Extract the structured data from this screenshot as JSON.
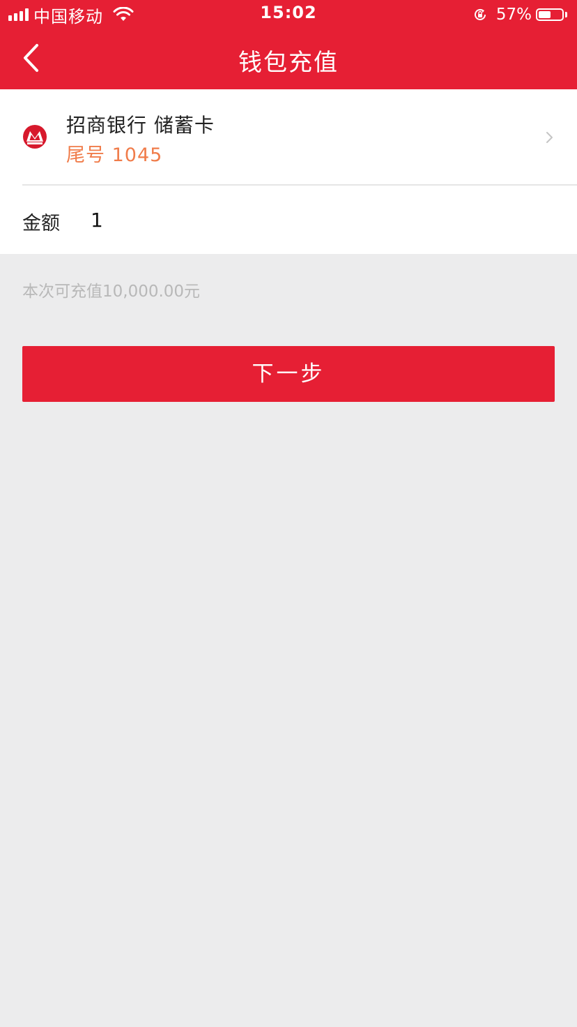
{
  "status_bar": {
    "carrier": "中国移动",
    "time": "15:02",
    "battery_percent": "57%",
    "battery_level": 0.57,
    "icons": [
      "signal-icon",
      "wifi-icon",
      "rotation-lock-icon",
      "battery-icon"
    ]
  },
  "nav": {
    "title": "钱包充值",
    "back_icon": "chevron-left-icon"
  },
  "card": {
    "bank_name": "招商银行 储蓄卡",
    "tail": "尾号 1045",
    "logo_icon": "cmb-logo-icon",
    "chevron_icon": "chevron-right-icon"
  },
  "amount": {
    "label": "金额",
    "value": "1"
  },
  "limit_hint": "本次可充值10,000.00元",
  "next_button": "下一步",
  "colors": {
    "brand_red": "#e61f34",
    "tail_orange": "#f07c4a",
    "background": "#ececed"
  }
}
